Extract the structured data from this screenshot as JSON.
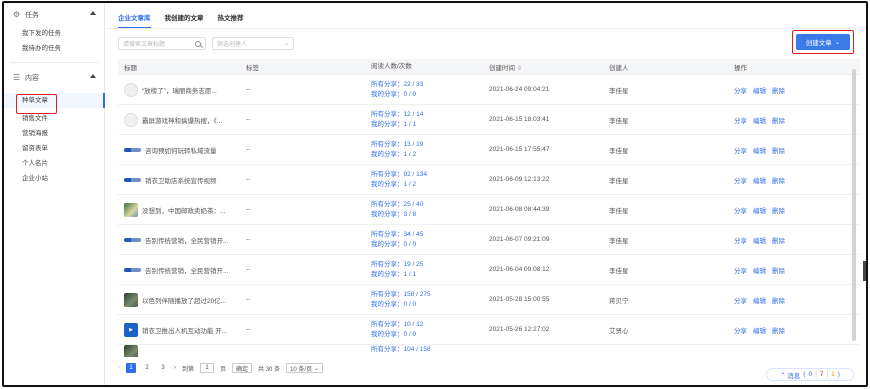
{
  "sidebar": {
    "groups": [
      {
        "label": "任务",
        "icon": "settings-icon",
        "items": [
          "我下发的任务",
          "我待办的任务"
        ]
      },
      {
        "label": "内容",
        "icon": "list-icon",
        "items": [
          "种草文章",
          "销售文件",
          "营销海报",
          "留资表单",
          "个人名片",
          "企业小站"
        ]
      }
    ],
    "active_item": "种草文章"
  },
  "tabs": [
    "企业文章库",
    "我创建的文章",
    "热文推荐"
  ],
  "active_tab": "企业文章库",
  "filters": {
    "search_placeholder": "请搜索文章标题",
    "creator_placeholder": "筛选创建人"
  },
  "create_button": "创建文章",
  "table": {
    "columns": [
      "标题",
      "标签",
      "阅读人数/次数",
      "创建时间",
      "创建人",
      "操作"
    ],
    "rows": [
      {
        "title": "“放榜了”，瑞丽商务志愿...",
        "tag": "--",
        "read_all": "所有分享：22 / 33",
        "read_mine": "我的分享：0 / 0",
        "time": "2021-06-24 09:04:21",
        "creator": "李佳星",
        "thumb": "gray"
      },
      {
        "title": "霸屏游戏神和搞爆热搜，《...",
        "tag": "--",
        "read_all": "所有分享：12 / 14",
        "read_mine": "我的分享：1 / 1",
        "time": "2021-06-15 18:03:41",
        "creator": "李佳星",
        "thumb": "gray"
      },
      {
        "title": "咨询预如何玩转私域流量",
        "tag": "--",
        "read_all": "所有分享：13 / 19",
        "read_mine": "我的分享：1 / 2",
        "time": "2021-06-15 17:55:47",
        "creator": "李佳星",
        "thumb": "logo"
      },
      {
        "title": "销衣卫助店系统宣传视频",
        "tag": "--",
        "read_all": "所有分享：92 / 134",
        "read_mine": "我的分享：1 / 2",
        "time": "2021-06-09 12:13:22",
        "creator": "李佳星",
        "thumb": "logo"
      },
      {
        "title": "没想到，中国邮政卖奶茶：...",
        "tag": "--",
        "read_all": "所有分享：25 / 40",
        "read_mine": "我的分享：3 / 8",
        "time": "2021-06-08 08:44:39",
        "creator": "李佳星",
        "thumb": "photo"
      },
      {
        "title": "告别传统营销，全民营销开...",
        "tag": "--",
        "read_all": "所有分享：34 / 45",
        "read_mine": "我的分享：0 / 0",
        "time": "2021-06-07 09:21:09",
        "creator": "李佳星",
        "thumb": "logo"
      },
      {
        "title": "告别传统营销，全民营销开...",
        "tag": "--",
        "read_all": "所有分享：19 / 25",
        "read_mine": "我的分享：1 / 1",
        "time": "2021-06-04 09:08:12",
        "creator": "李佳星",
        "thumb": "logo"
      },
      {
        "title": "以色列伴随播放了超过20亿...",
        "tag": "--",
        "read_all": "所有分享：158 / 275",
        "read_mine": "我的分享：0 / 0",
        "time": "2021-05-28 15:00:55",
        "creator": "蒋贝宁",
        "thumb": "dark"
      },
      {
        "title": "销衣卫推出人机互动功能 开...",
        "tag": "--",
        "read_all": "所有分享：10 / 12",
        "read_mine": "我的分享：0 / 0",
        "time": "2021-05-26 12:27:02",
        "creator": "艾贤心",
        "thumb": "blue"
      },
      {
        "title": "",
        "tag": "",
        "read_all": "所有分享：104 / 158",
        "read_mine": "",
        "time": "",
        "creator": "",
        "thumb": "dark"
      }
    ],
    "actions": [
      "分享",
      "编辑",
      "删除"
    ]
  },
  "pagination": {
    "pages": [
      "1",
      "2",
      "3"
    ],
    "current": "1",
    "goto_label": "到第",
    "goto_value": "1",
    "page_suffix": "页",
    "confirm": "确定",
    "total": "共 30 条",
    "page_size": "10 条/页"
  },
  "message_bar": {
    "label": "消息",
    "counts": [
      "0",
      "7",
      "1"
    ]
  }
}
